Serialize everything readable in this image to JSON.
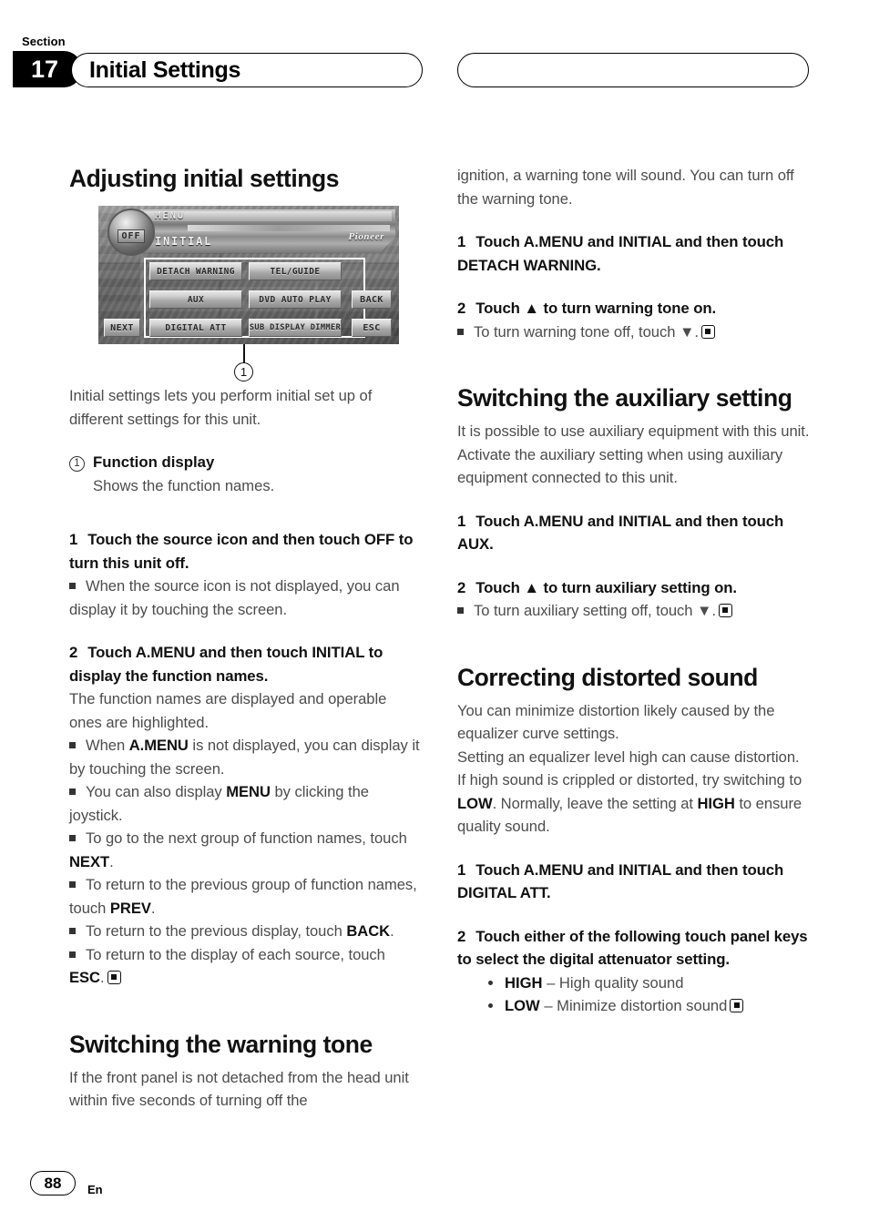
{
  "header": {
    "section_label": "Section",
    "section_number": "17",
    "title": "Initial Settings",
    "right_pill_text": ""
  },
  "footer": {
    "page_number": "88",
    "language": "En"
  },
  "left_column": {
    "heading": "Adjusting initial settings",
    "device": {
      "label_menu": "MENU",
      "label_initial": "INITIAL",
      "brand": "Pioneer",
      "off_button": "OFF",
      "keys": [
        "DETACH WARNING",
        "TEL/GUIDE",
        "AUX",
        "DVD AUTO PLAY",
        "DIGITAL ATT",
        "SUB DISPLAY DIMMER"
      ],
      "side_keys": [
        "BACK",
        "ESC"
      ],
      "next_key": "NEXT",
      "callout_number": "1"
    },
    "intro": "Initial settings lets you perform initial set up of different settings for this unit.",
    "callout": {
      "number": "1",
      "title": "Function display",
      "description": "Shows the function names."
    },
    "step1": {
      "num": "1",
      "text": "Touch the source icon and then touch OFF to turn this unit off."
    },
    "step1_bullet": "When the source icon is not displayed, you can display it by touching the screen.",
    "step2": {
      "num": "2",
      "text": "Touch A.MENU and then touch INITIAL to display the function names."
    },
    "step2_body": "The function names are displayed and operable ones are highlighted.",
    "step2_bullets": [
      {
        "pre": "When ",
        "bold": "A.MENU",
        "post": " is not displayed, you can display it by touching the screen."
      },
      {
        "pre": "You can also display ",
        "bold": "MENU",
        "post": " by clicking the joystick."
      },
      {
        "pre": "To go to the next group of function names, touch ",
        "bold": "NEXT",
        "post": "."
      },
      {
        "pre": "To return to the previous group of function names, touch ",
        "bold": "PREV",
        "post": "."
      },
      {
        "pre": "To return to the previous display, touch ",
        "bold": "BACK",
        "post": "."
      },
      {
        "pre": "To return to the display of each source, touch ",
        "bold": "ESC",
        "post": "."
      }
    ],
    "heading2": "Switching the warning tone",
    "warning_body": "If the front panel is not detached from the head unit within five seconds of turning off the"
  },
  "right_column": {
    "continued": "ignition, a warning tone will sound. You can turn off the warning tone.",
    "warn_step1": {
      "num": "1",
      "text": "Touch A.MENU and INITIAL and then touch DETACH WARNING."
    },
    "warn_step2": {
      "num": "2",
      "text": "Touch ▲ to turn warning tone on."
    },
    "warn_step2_bullet": "To turn warning tone off, touch ▼.",
    "heading_aux": "Switching the auxiliary setting",
    "aux_body": "It is possible to use auxiliary equipment with this unit. Activate the auxiliary setting when using auxiliary equipment connected to this unit.",
    "aux_step1": {
      "num": "1",
      "text": "Touch A.MENU and INITIAL and then touch AUX."
    },
    "aux_step2": {
      "num": "2",
      "text": "Touch ▲ to turn auxiliary setting on."
    },
    "aux_step2_bullet": "To turn auxiliary setting off, touch ▼.",
    "heading_distort": "Correcting distorted sound",
    "distort_body1": "You can minimize distortion likely caused by the equalizer curve settings.",
    "distort_body2_pre": "Setting an equalizer level high can cause distortion. If high sound is crippled or distorted, try switching to ",
    "distort_body2_low": "LOW",
    "distort_body2_mid": ". Normally, leave the setting at ",
    "distort_body2_high": "HIGH",
    "distort_body2_post": " to ensure quality sound.",
    "dist_step1": {
      "num": "1",
      "text": "Touch A.MENU and INITIAL and then touch DIGITAL ATT."
    },
    "dist_step2": {
      "num": "2",
      "text": "Touch either of the following touch panel keys to select the digital attenuator setting."
    },
    "dist_options": [
      {
        "key": "HIGH",
        "desc": " – High quality sound"
      },
      {
        "key": "LOW",
        "desc": " – Minimize distortion sound"
      }
    ]
  }
}
